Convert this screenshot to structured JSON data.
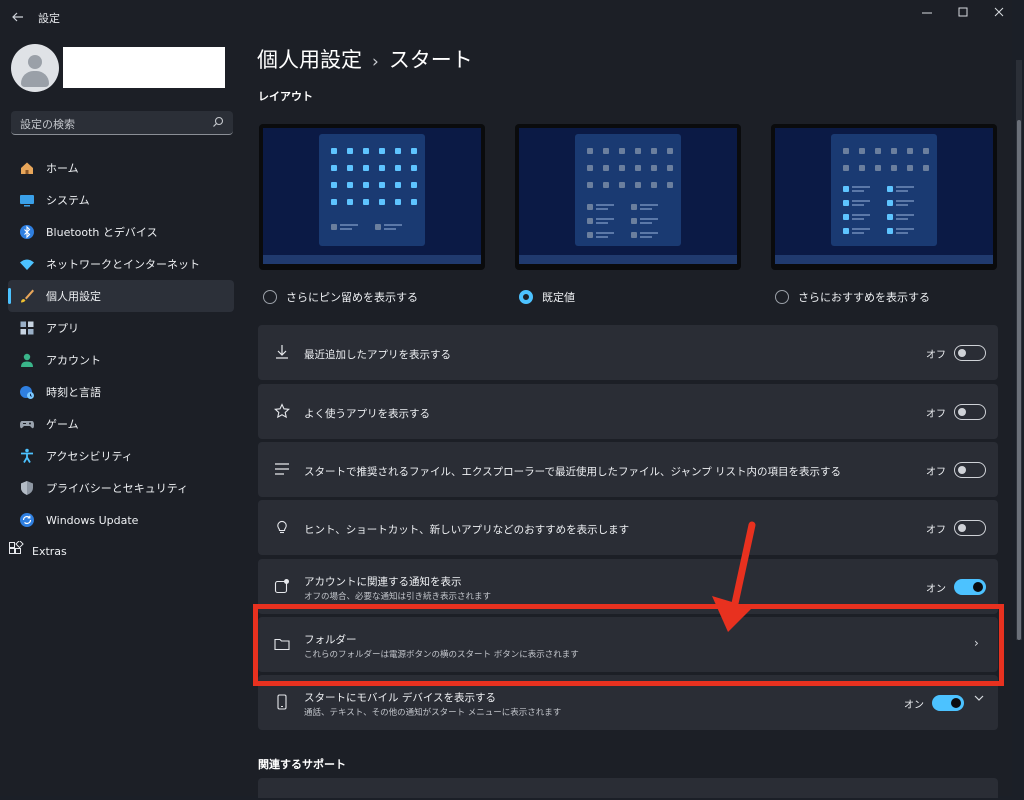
{
  "app": {
    "title": "設定"
  },
  "search": {
    "placeholder": "設定の検索"
  },
  "nav": [
    {
      "label": "ホーム",
      "icon": "home-icon"
    },
    {
      "label": "システム",
      "icon": "system-icon"
    },
    {
      "label": "Bluetooth とデバイス",
      "icon": "bluetooth-icon"
    },
    {
      "label": "ネットワークとインターネット",
      "icon": "wifi-icon"
    },
    {
      "label": "個人用設定",
      "icon": "brush-icon",
      "active": true
    },
    {
      "label": "アプリ",
      "icon": "apps-icon"
    },
    {
      "label": "アカウント",
      "icon": "account-icon"
    },
    {
      "label": "時刻と言語",
      "icon": "globe-clock-icon"
    },
    {
      "label": "ゲーム",
      "icon": "gamepad-icon"
    },
    {
      "label": "アクセシビリティ",
      "icon": "accessibility-icon"
    },
    {
      "label": "プライバシーとセキュリティ",
      "icon": "shield-icon"
    },
    {
      "label": "Windows Update",
      "icon": "update-icon"
    }
  ],
  "extras": {
    "label": "Extras",
    "icon": "extras-icon"
  },
  "header": {
    "crumb": "個人用設定",
    "separator": "›",
    "title": "スタート"
  },
  "layout": {
    "section": "レイアウト",
    "options": [
      {
        "label": "さらにピン留めを表示する",
        "selected": false
      },
      {
        "label": "既定値",
        "selected": true
      },
      {
        "label": "さらにおすすめを表示する",
        "selected": false
      }
    ]
  },
  "settings": [
    {
      "label": "最近追加したアプリを表示する",
      "state": "オフ",
      "on": false,
      "icon": "download-icon"
    },
    {
      "label": "よく使うアプリを表示する",
      "state": "オフ",
      "on": false,
      "icon": "star-icon"
    },
    {
      "label": "スタートで推奨されるファイル、エクスプローラーで最近使用したファイル、ジャンプ リスト内の項目を表示する",
      "state": "オフ",
      "on": false,
      "icon": "list-icon"
    },
    {
      "label": "ヒント、ショートカット、新しいアプリなどのおすすめを表示します",
      "state": "オフ",
      "on": false,
      "icon": "lightbulb-icon"
    },
    {
      "label": "アカウントに関連する通知を表示",
      "sub": "オフの場合、必要な通知は引き続き表示されます",
      "state": "オン",
      "on": true,
      "icon": "account-badge-icon"
    },
    {
      "label": "フォルダー",
      "sub": "これらのフォルダーは電源ボタンの横のスタート ボタンに表示されます",
      "icon": "folder-icon"
    },
    {
      "label": "スタートにモバイル デバイスを表示する",
      "sub": "通話、テキスト、その他の通知がスタート メニューに表示されます",
      "state": "オン",
      "on": true,
      "icon": "phone-icon"
    }
  ],
  "support": {
    "section": "関連するサポート"
  },
  "colors": {
    "accent": "#4cc2ff",
    "highlight": "#e8311f",
    "row_bg": "#2a2d35",
    "window_bg": "#1c1f26"
  }
}
